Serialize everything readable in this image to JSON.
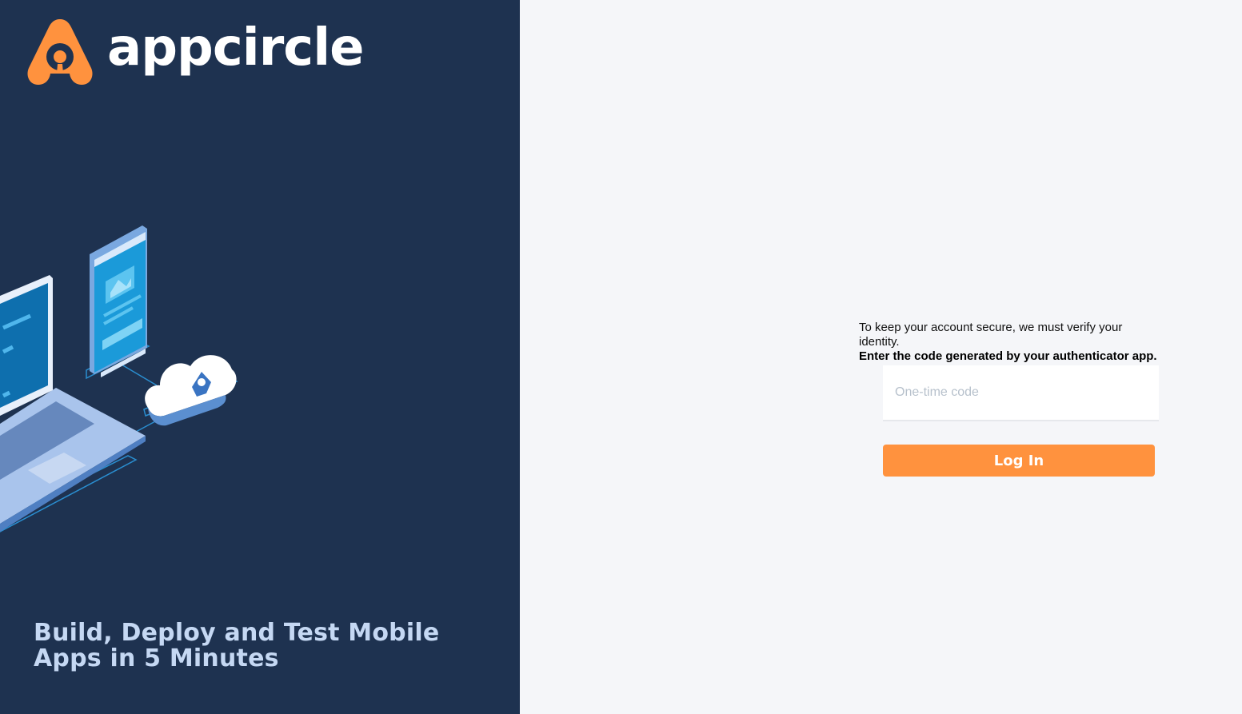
{
  "brand": {
    "name": "appcircle",
    "logo_icon": "appcircle-logo-icon",
    "accent_color": "#ff923e",
    "panel_color": "#1e3250"
  },
  "left_panel": {
    "illustration": "devices-cloud-illustration",
    "tagline": "Build, Deploy and Test Mobile Apps in 5 Minutes"
  },
  "auth": {
    "info_text": "To keep your account secure, we must verify your identity.",
    "instruction_text": "Enter the code generated by your authenticator app.",
    "otp_input": {
      "placeholder": "One-time code",
      "value": ""
    },
    "login_button_label": "Log In"
  }
}
